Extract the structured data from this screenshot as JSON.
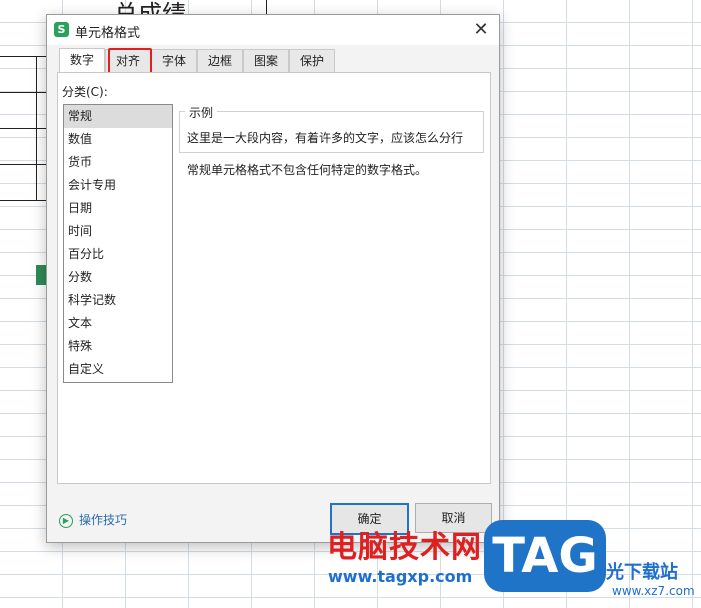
{
  "sheet": {
    "cell_title": "总成绩"
  },
  "dialog": {
    "title": "单元格格式",
    "app_icon": "S",
    "close_glyph": "✕",
    "tabs": [
      "数字",
      "对齐",
      "字体",
      "边框",
      "图案",
      "保护"
    ],
    "active_tab": "数字",
    "highlighted_tab": "对齐",
    "category_label": "分类(C):",
    "categories": [
      "常规",
      "数值",
      "货币",
      "会计专用",
      "日期",
      "时间",
      "百分比",
      "分数",
      "科学记数",
      "文本",
      "特殊",
      "自定义"
    ],
    "selected_category": "常规",
    "sample_label": "示例",
    "sample_text": "这里是一大段内容，有着许多的文字，应该怎么分行",
    "description": "常规单元格格式不包含任何特定的数字格式。",
    "tips_label": "操作技巧",
    "ok_label": "确定",
    "cancel_label": "取消"
  },
  "watermark": {
    "cn": "电脑技术网",
    "url": "www.tagxp.com",
    "tag": "TAG",
    "right_cn": "光下载站",
    "right_url": "www.xz7.com"
  },
  "colors": {
    "accent": "#2aa15a",
    "highlight": "#e02020",
    "primary_border": "#1f74c7"
  }
}
